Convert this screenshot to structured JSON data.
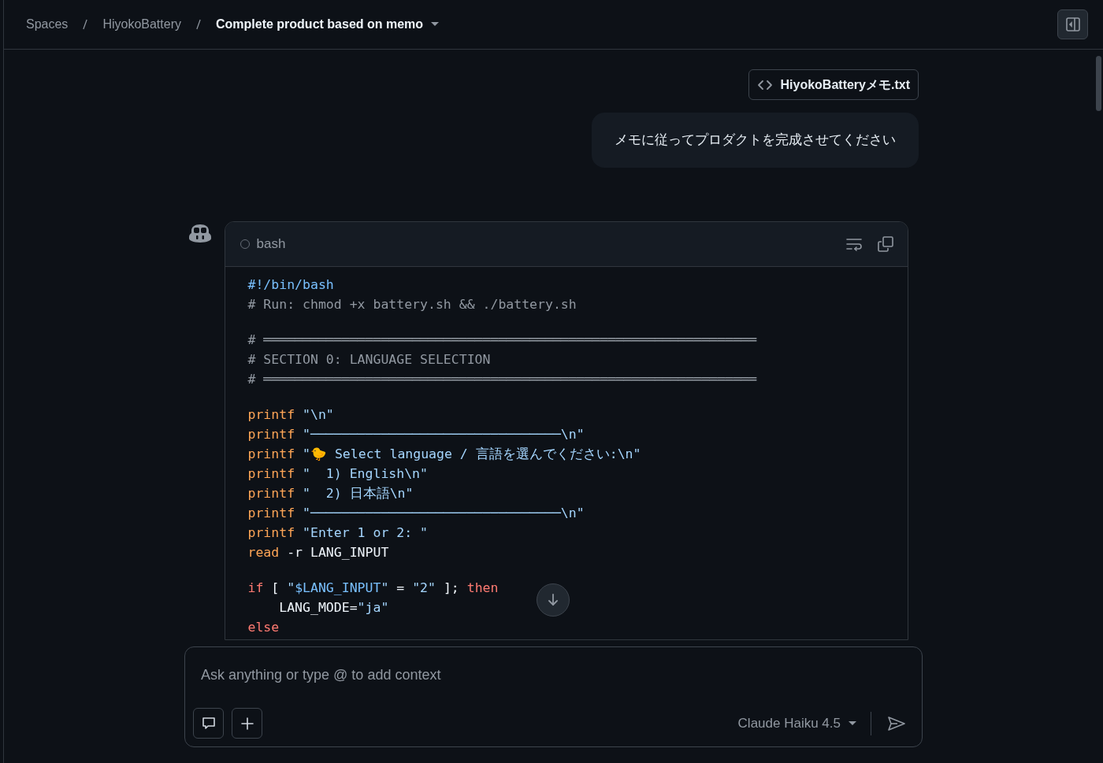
{
  "breadcrumb": [
    {
      "label": "Spaces",
      "current": false
    },
    {
      "label": "HiyokoBattery",
      "current": false
    },
    {
      "label": "Complete product based on memo",
      "current": true
    }
  ],
  "attachment": {
    "name": "HiyokoBatteryメモ.txt"
  },
  "user_message": "メモに従ってプロダクトを完成させてください",
  "code_block": {
    "language": "bash",
    "lines": [
      {
        "tokens": [
          {
            "kind": "shebang",
            "text": "#!/bin/bash"
          }
        ]
      },
      {
        "tokens": [
          {
            "kind": "comment",
            "text": "# Run: chmod +x battery.sh && ./battery.sh"
          }
        ]
      },
      {
        "space_before": true,
        "tokens": [
          {
            "kind": "comment",
            "text": "# ═══════════════════════════════════════════════════════════════"
          }
        ]
      },
      {
        "tokens": [
          {
            "kind": "comment",
            "text": "# SECTION 0: LANGUAGE SELECTION"
          }
        ]
      },
      {
        "tokens": [
          {
            "kind": "comment",
            "text": "# ═══════════════════════════════════════════════════════════════"
          }
        ]
      },
      {
        "space_before": true,
        "tokens": [
          {
            "kind": "builtin",
            "text": "printf"
          },
          {
            "kind": "string",
            "text": " \"\\n\""
          }
        ]
      },
      {
        "tokens": [
          {
            "kind": "builtin",
            "text": "printf"
          },
          {
            "kind": "string",
            "text": " \"────────────────────────────────\\n\""
          }
        ]
      },
      {
        "tokens": [
          {
            "kind": "builtin",
            "text": "printf"
          },
          {
            "kind": "string",
            "text": " \"🐤 Select language / 言語を選んでください:\\n\""
          }
        ]
      },
      {
        "tokens": [
          {
            "kind": "builtin",
            "text": "printf"
          },
          {
            "kind": "string",
            "text": " \"  1) English\\n\""
          }
        ]
      },
      {
        "tokens": [
          {
            "kind": "builtin",
            "text": "printf"
          },
          {
            "kind": "string",
            "text": " \"  2) 日本語\\n\""
          }
        ]
      },
      {
        "tokens": [
          {
            "kind": "builtin",
            "text": "printf"
          },
          {
            "kind": "string",
            "text": " \"────────────────────────────────\\n\""
          }
        ]
      },
      {
        "tokens": [
          {
            "kind": "builtin",
            "text": "printf"
          },
          {
            "kind": "string",
            "text": " \"Enter 1 or 2: \""
          }
        ]
      },
      {
        "tokens": [
          {
            "kind": "builtin",
            "text": "read"
          },
          {
            "kind": "plain",
            "text": " -r LANG_INPUT"
          }
        ]
      },
      {
        "space_before": true,
        "tokens": [
          {
            "kind": "control",
            "text": "if"
          },
          {
            "kind": "plain",
            "text": " [ "
          },
          {
            "kind": "string",
            "text": "\""
          },
          {
            "kind": "variable",
            "text": "$LANG_INPUT"
          },
          {
            "kind": "string",
            "text": "\""
          },
          {
            "kind": "plain",
            "text": " = "
          },
          {
            "kind": "string",
            "text": "\"2\""
          },
          {
            "kind": "plain",
            "text": " ]; "
          },
          {
            "kind": "control",
            "text": "then"
          }
        ]
      },
      {
        "tokens": [
          {
            "kind": "plain",
            "text": "    LANG_MODE="
          },
          {
            "kind": "string",
            "text": "\"ja\""
          }
        ]
      },
      {
        "tokens": [
          {
            "kind": "control",
            "text": "else"
          }
        ]
      }
    ]
  },
  "composer": {
    "placeholder": "Ask anything or type @ to add context",
    "model": "Claude Haiku 4.5"
  }
}
